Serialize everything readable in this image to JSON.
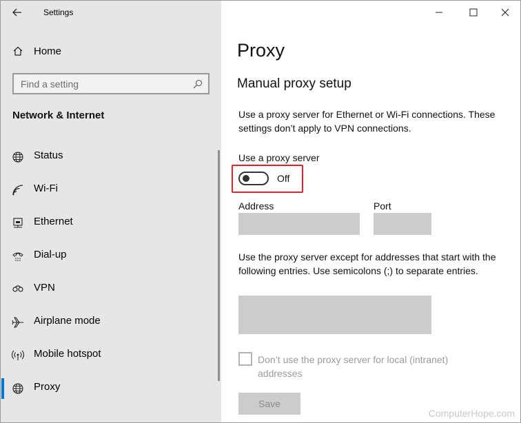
{
  "window": {
    "title": "Settings"
  },
  "sidebar": {
    "home_label": "Home",
    "search_placeholder": "Find a setting",
    "section_title": "Network & Internet",
    "items": [
      {
        "label": "Status",
        "icon": "globe-icon"
      },
      {
        "label": "Wi-Fi",
        "icon": "wifi-icon"
      },
      {
        "label": "Ethernet",
        "icon": "ethernet-icon"
      },
      {
        "label": "Dial-up",
        "icon": "phone-icon"
      },
      {
        "label": "VPN",
        "icon": "vpn-icon"
      },
      {
        "label": "Airplane mode",
        "icon": "airplane-icon"
      },
      {
        "label": "Mobile hotspot",
        "icon": "hotspot-icon"
      },
      {
        "label": "Proxy",
        "icon": "globe-icon",
        "active": true
      }
    ]
  },
  "main": {
    "page_title": "Proxy",
    "section_title": "Manual proxy setup",
    "description": "Use a proxy server for Ethernet or Wi-Fi connections. These settings don’t apply to VPN connections.",
    "toggle_label": "Use a proxy server",
    "toggle_state": "Off",
    "address_label": "Address",
    "address_value": "",
    "port_label": "Port",
    "port_value": "",
    "exceptions_description": "Use the proxy server except for addresses that start with the following entries. Use semicolons (;) to separate entries.",
    "exceptions_value": "",
    "checkbox_label": "Don’t use the proxy server for local (intranet) addresses",
    "save_label": "Save"
  },
  "watermark": "ComputerHope.com",
  "colors": {
    "sidebar_bg": "#e6e6e6",
    "accent": "#0078d7",
    "highlight": "#e0232c",
    "field_bg": "#cccccc"
  }
}
